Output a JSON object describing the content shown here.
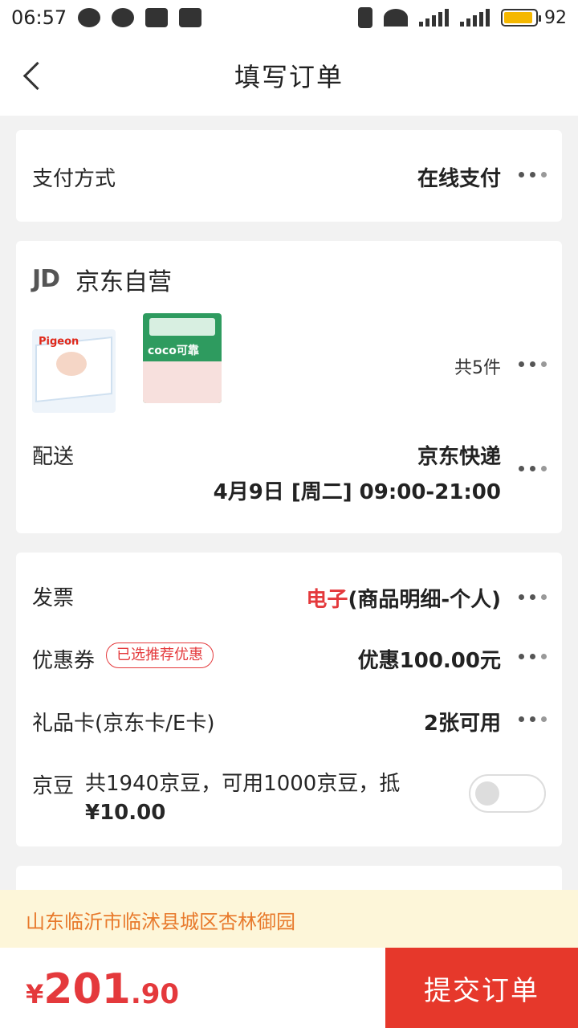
{
  "status_bar": {
    "time": "06:57",
    "battery": "92",
    "battery_level": 0.92,
    "network": "4G"
  },
  "header": {
    "title": "填写订单"
  },
  "payment": {
    "label": "支付方式",
    "value": "在线支付"
  },
  "shop": {
    "logo": "JD",
    "name": "京东自营",
    "products": [
      {
        "brand": "Pigeon"
      },
      {
        "brand": "coco可靠"
      }
    ],
    "quantity": "共5件",
    "delivery_label": "配送",
    "delivery_method": "京东快递",
    "delivery_time": "4月9日 [周二] 09:00-21:00"
  },
  "extras": {
    "invoice_label": "发票",
    "invoice_type": "电子",
    "invoice_detail": "(商品明细-个人)",
    "coupon_label": "优惠券",
    "coupon_badge": "已选推荐优惠",
    "coupon_value": "优惠100.00元",
    "giftcard_label": "礼品卡(京东卡/E卡)",
    "giftcard_value": "2张可用",
    "beans_label": "京豆",
    "beans_desc_line1": "共1940京豆，可用1000京豆，抵",
    "beans_desc_line2": "¥10.00",
    "beans_enabled": false
  },
  "address": {
    "text": "山东临沂市临沭县城区杏林御园"
  },
  "footer": {
    "currency": "¥",
    "price_int": "201",
    "price_dec": ".90",
    "submit_label": "提交订单"
  },
  "colors": {
    "accent": "#e4393c",
    "address_text": "#e87a2c",
    "address_bg": "#fdf6d9",
    "battery": "#f5b800"
  }
}
